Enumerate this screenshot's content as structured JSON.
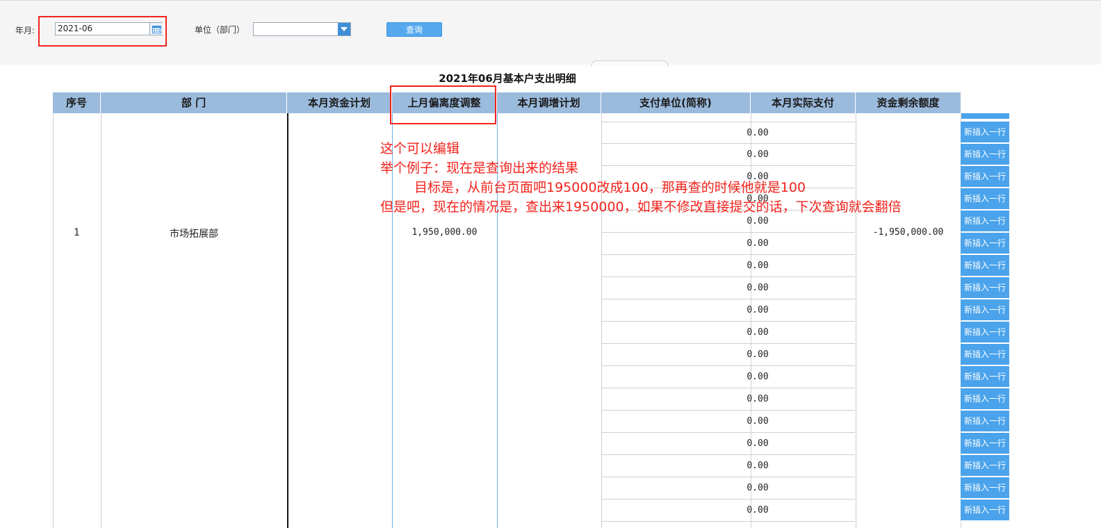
{
  "filters": {
    "year_month_label": "年月:",
    "year_month_value": "2021-06",
    "unit_label": "单位（部门）",
    "unit_value": "",
    "query_button": "查询"
  },
  "report": {
    "title": "2021年06月基本户支出明细",
    "columns": [
      "序号",
      "部 门",
      "本月资金计划",
      "上月偏离度调整",
      "本月调增计划",
      "支付单位(简称)",
      "本月实际支付",
      "资金剩余额度"
    ],
    "row": {
      "index": "1",
      "department": "市场拓展部",
      "deviation_adjustment": "1,950,000.00",
      "remaining": "-1,950,000.00"
    },
    "payment_rows": [
      "0.00",
      "0.00",
      "0.00",
      "0.00",
      "0.00",
      "0.00",
      "0.00",
      "0.00",
      "0.00",
      "0.00",
      "0.00",
      "0.00",
      "0.00",
      "0.00",
      "0.00",
      "0.00",
      "0.00",
      "0.00"
    ],
    "insert_buttons": [
      "新插入一行",
      "新插入一行",
      "新插入一行",
      "新插入一行",
      "新插入一行",
      "新插入一行",
      "新插入一行",
      "新插入一行",
      "新插入一行",
      "新插入一行",
      "新插入一行",
      "新插入一行",
      "新插入一行",
      "新插入一行",
      "新插入一行",
      "新插入一行",
      "新插入一行",
      "新插入一行"
    ]
  },
  "annotations": {
    "line1": "这个可以编辑",
    "line2": "举个例子：现在是查询出来的结果",
    "line3": "目标是，从前台页面吧195000改成100，那再查的时候他就是100",
    "line4": "但是吧，现在的情况是，查出来1950000，如果不修改直接提交的话，下次查询就会翻倍"
  },
  "colors": {
    "header_bg": "#9bbbdd",
    "button_blue": "#4aa3eb",
    "highlight_red": "#f2231c"
  }
}
